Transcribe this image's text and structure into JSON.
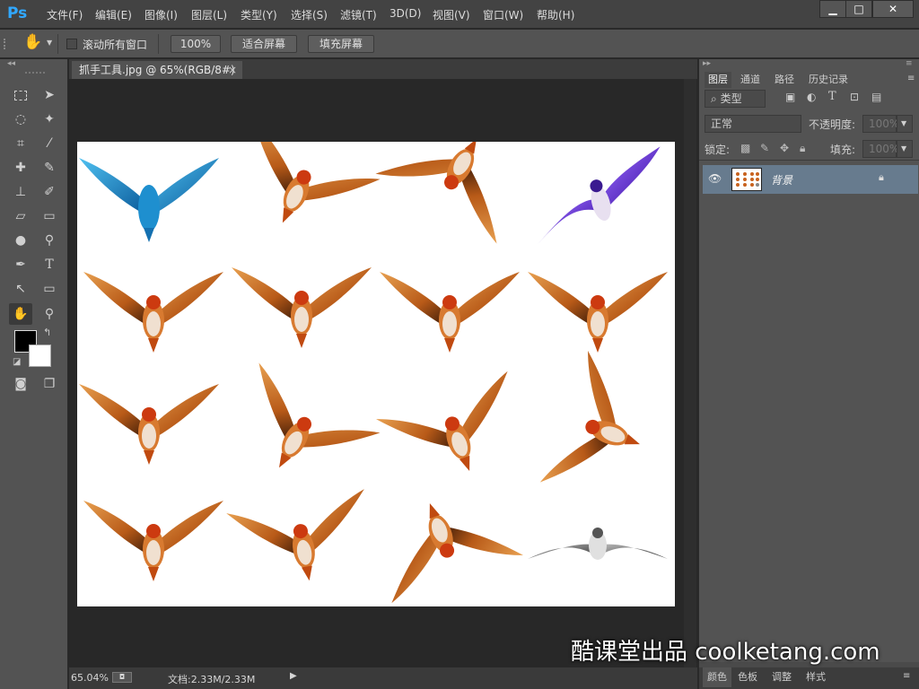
{
  "app": {
    "logo": "Ps"
  },
  "menu": [
    "文件(F)",
    "编辑(E)",
    "图像(I)",
    "图层(L)",
    "类型(Y)",
    "选择(S)",
    "滤镜(T)",
    "3D(D)",
    "视图(V)",
    "窗口(W)",
    "帮助(H)"
  ],
  "window_controls": {
    "minimize": "▁",
    "maximize": "□",
    "close": "✕"
  },
  "options": {
    "scroll_all_label": "滚动所有窗口",
    "zoom_100": "100%",
    "fit_screen": "适合屏幕",
    "fill_screen": "填充屏幕"
  },
  "document": {
    "tab_title": "抓手工具.jpg @ 65%(RGB/8#)",
    "close": "×"
  },
  "status": {
    "zoom": "65.04%",
    "doc_info": "文档:2.33M/2.33M"
  },
  "layers_panel": {
    "tabs": [
      "图层",
      "通道",
      "路径",
      "历史记录"
    ],
    "filter_kind": "类型",
    "blend_mode": "正常",
    "opacity_label": "不透明度:",
    "opacity_value": "100%",
    "lock_label": "锁定:",
    "fill_label": "填充:",
    "fill_value": "100%",
    "layer_name": "背景"
  },
  "bottom_tabs": [
    "颜色",
    "色板",
    "调整",
    "样式"
  ],
  "watermark": "酷课堂出品 coolketang.com",
  "colors": {
    "accent": "#31a8ff",
    "bird_orange": "#c8621e",
    "bird_blue": "#1e8fcf",
    "bird_purple": "#6a2fd6",
    "bird_gray": "#8a8a8a"
  }
}
